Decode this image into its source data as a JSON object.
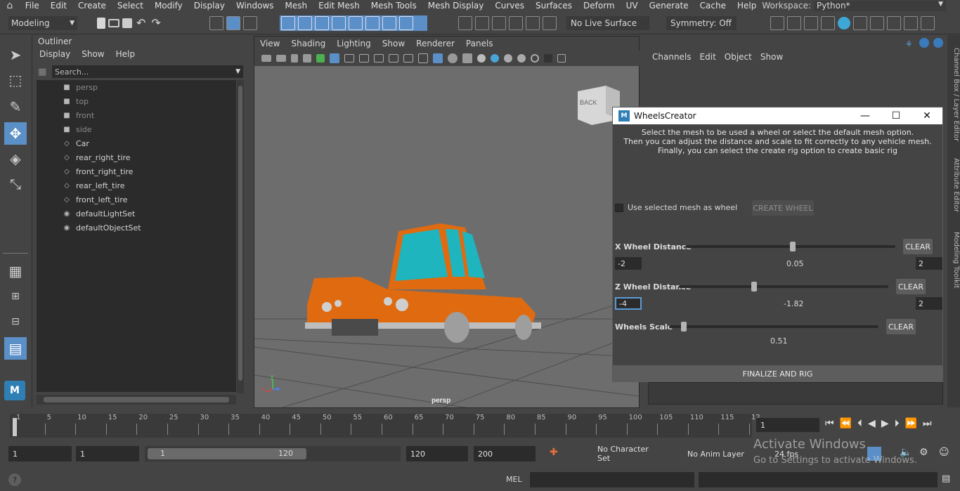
{
  "menubar": {
    "items": [
      "File",
      "Edit",
      "Create",
      "Select",
      "Modify",
      "Display",
      "Windows",
      "Mesh",
      "Edit Mesh",
      "Mesh Tools",
      "Mesh Display",
      "Curves",
      "Surfaces",
      "Deform",
      "UV",
      "Generate",
      "Cache",
      "Help"
    ],
    "workspace_label": "Workspace:",
    "workspace_value": "Python*"
  },
  "statusline": {
    "mode": "Modeling",
    "live_surface": "No Live Surface",
    "symmetry": "Symmetry: Off"
  },
  "outliner": {
    "title": "Outliner",
    "menus": [
      "Display",
      "Show",
      "Help"
    ],
    "search_placeholder": "Search...",
    "items": [
      {
        "label": "persp",
        "icon": "camera-icon",
        "dim": true
      },
      {
        "label": "top",
        "icon": "camera-icon",
        "dim": true
      },
      {
        "label": "front",
        "icon": "camera-icon",
        "dim": true
      },
      {
        "label": "side",
        "icon": "camera-icon",
        "dim": true
      },
      {
        "label": "Car",
        "icon": "mesh-icon",
        "dim": false
      },
      {
        "label": "rear_right_tire",
        "icon": "mesh-icon",
        "dim": false
      },
      {
        "label": "front_right_tire",
        "icon": "mesh-icon",
        "dim": false
      },
      {
        "label": "rear_left_tire",
        "icon": "mesh-icon",
        "dim": false
      },
      {
        "label": "front_left_tire",
        "icon": "mesh-icon",
        "dim": false
      },
      {
        "label": "defaultLightSet",
        "icon": "set-icon",
        "dim": false
      },
      {
        "label": "defaultObjectSet",
        "icon": "set-icon",
        "dim": false
      }
    ]
  },
  "viewport": {
    "menus": [
      "View",
      "Shading",
      "Lighting",
      "Show",
      "Renderer",
      "Panels"
    ],
    "camera_label": "persp",
    "viewcube_label": "BACK",
    "axis_x": "x",
    "axis_y": "y",
    "axis_z": "z"
  },
  "channelbox": {
    "menus": [
      "Channels",
      "Edit",
      "Object",
      "Show"
    ]
  },
  "side_tabs": [
    "Channel Box / Layer Editor",
    "Attribute Editor",
    "Modeling Toolkit"
  ],
  "dialog": {
    "title": "WheelsCreator",
    "instructions": [
      "Select the mesh to be used a wheel or select the default mesh option.",
      "Then you can adjust the distance and scale to fit correctly to any vehicle mesh.",
      "Finally, you can select the create rig option to create basic rig"
    ],
    "use_selected_label": "Use selected mesh as wheel",
    "create_wheel": "CREATE WHEEL",
    "x_distance": {
      "label": "X Wheel Distance",
      "min": "-2",
      "max": "2",
      "value": "0.05",
      "level": 0.51,
      "clear": "CLEAR"
    },
    "z_distance": {
      "label": "Z Wheel Distance",
      "min": "-4",
      "max": "2",
      "value": "-1.82",
      "level": 0.36,
      "clear": "CLEAR"
    },
    "scale": {
      "label": "Wheels Scale",
      "value": "0.51",
      "level": 0.07,
      "clear": "CLEAR"
    },
    "finalize": "FINALIZE AND RIG"
  },
  "timeline": {
    "ticks": [
      "1",
      "5",
      "10",
      "15",
      "20",
      "25",
      "30",
      "35",
      "40",
      "45",
      "50",
      "55",
      "60",
      "65",
      "70",
      "75",
      "80",
      "85",
      "90",
      "95",
      "100",
      "105",
      "110",
      "115",
      "12"
    ],
    "current_frame": "1"
  },
  "range": {
    "start": "1",
    "playback_start": "1",
    "slider_start": "1",
    "slider_end": "120",
    "playback_end": "120",
    "end": "200",
    "character_set": "No Character Set",
    "anim_layer": "No Anim Layer",
    "fps": "24 fps"
  },
  "cmdline": {
    "lang": "MEL",
    "watermark_title": "Activate Windows",
    "watermark_sub": "Go to Settings to activate Windows."
  },
  "colors": {
    "car_body": "#e06a10",
    "glass": "#1fb5bf",
    "accent": "#5b9bd5"
  }
}
